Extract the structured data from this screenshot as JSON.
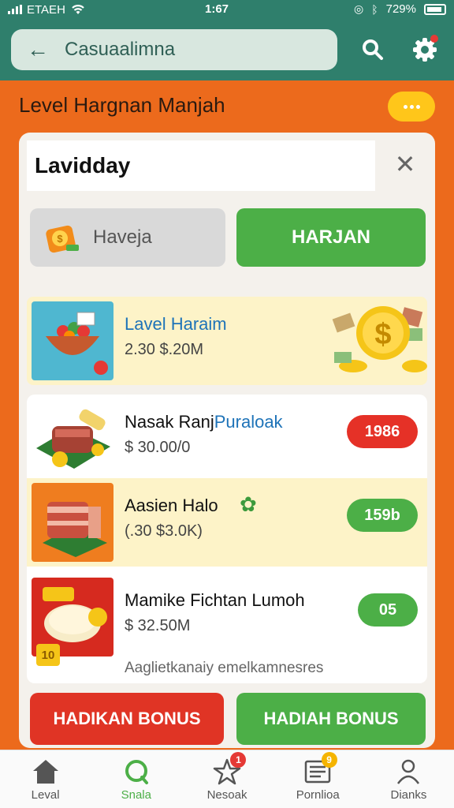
{
  "status_bar": {
    "carrier": "ETAЕН",
    "time": "1:67",
    "battery": "729%"
  },
  "app_bar": {
    "title": "Casuaalimna"
  },
  "heading": "Level Hargnan Manjah",
  "search": {
    "value": "Lavidday"
  },
  "buttons": {
    "secondary_label": "Haveja",
    "primary_label": "HARJAN"
  },
  "rows": [
    {
      "title": "Lavel Haraim",
      "sub": "2.30 $.20M"
    },
    {
      "title": "Nasak Ranj",
      "title_accent": "Puraloak",
      "sub": "$ 30.00/0",
      "badge": "1986",
      "badge_color": "#e53127"
    },
    {
      "title": "Aasien Halo",
      "sub": "(.30 $3.0K)",
      "badge": "159b",
      "badge_color": "#4caf47"
    },
    {
      "title": "Mamike Fichtan Lumoh",
      "sub": "$ 32.50M",
      "badge": "05",
      "badge_color": "#4caf47",
      "extra": "Aaglietkanaiy emelkamnesres",
      "tag": "10"
    }
  ],
  "bonus": {
    "left_label": "HADIKAN BONUS",
    "right_label": "HADIAH BONUS",
    "left_color": "#e03425",
    "right_color": "#4caf47"
  },
  "nav": [
    {
      "label": "Leval",
      "icon": "home-icon"
    },
    {
      "label": "Snala",
      "icon": "search-icon",
      "active": true
    },
    {
      "label": "Nesoak",
      "icon": "star-icon",
      "badge": "1",
      "badge_color": "#e53935"
    },
    {
      "label": "Pornlioa",
      "icon": "news-icon",
      "badge": "9",
      "badge_color": "#f5b400"
    },
    {
      "label": "Dianks",
      "icon": "profile-icon"
    }
  ]
}
